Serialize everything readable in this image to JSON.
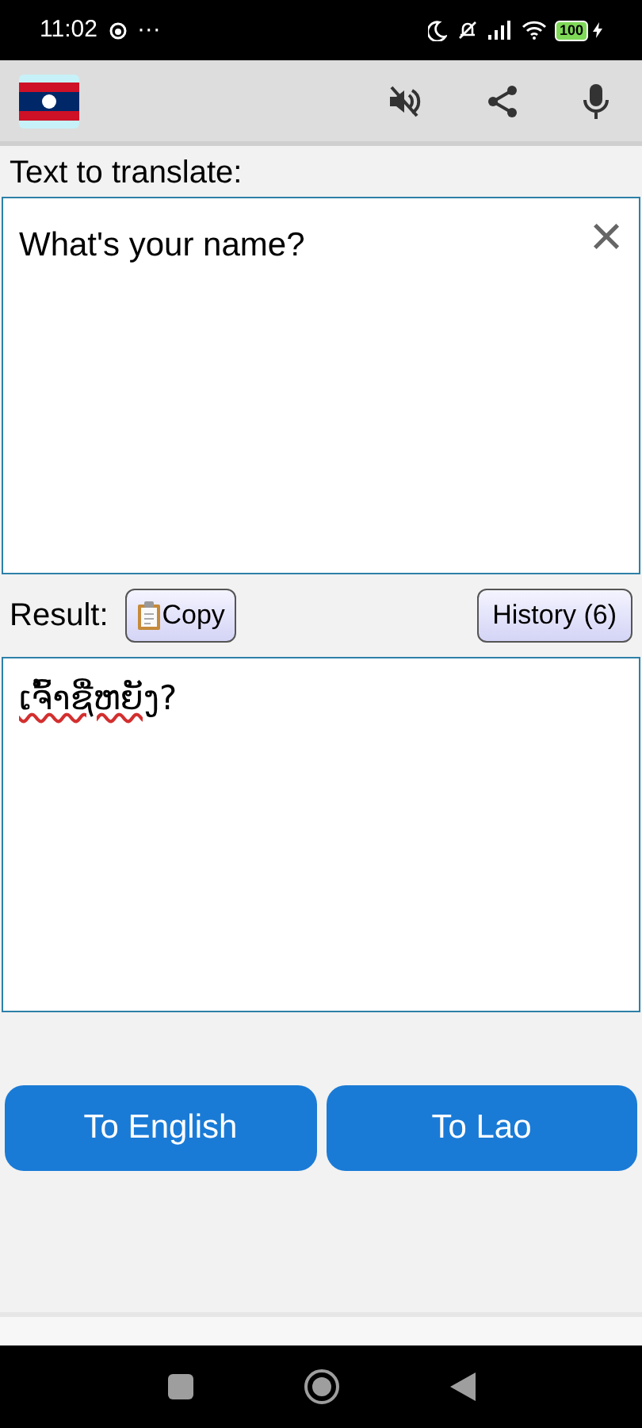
{
  "status_bar": {
    "time": "11:02",
    "more": "···",
    "battery": "100"
  },
  "input": {
    "label": "Text to translate:",
    "value": "What's your name?",
    "clear": "×"
  },
  "result": {
    "label": "Result:",
    "copy": "Copy",
    "history": "History (6)",
    "text": "ເຈົ້າຊື່ຫຍັງ",
    "tail": "?"
  },
  "buttons": [
    "To English",
    "To Lao"
  ]
}
